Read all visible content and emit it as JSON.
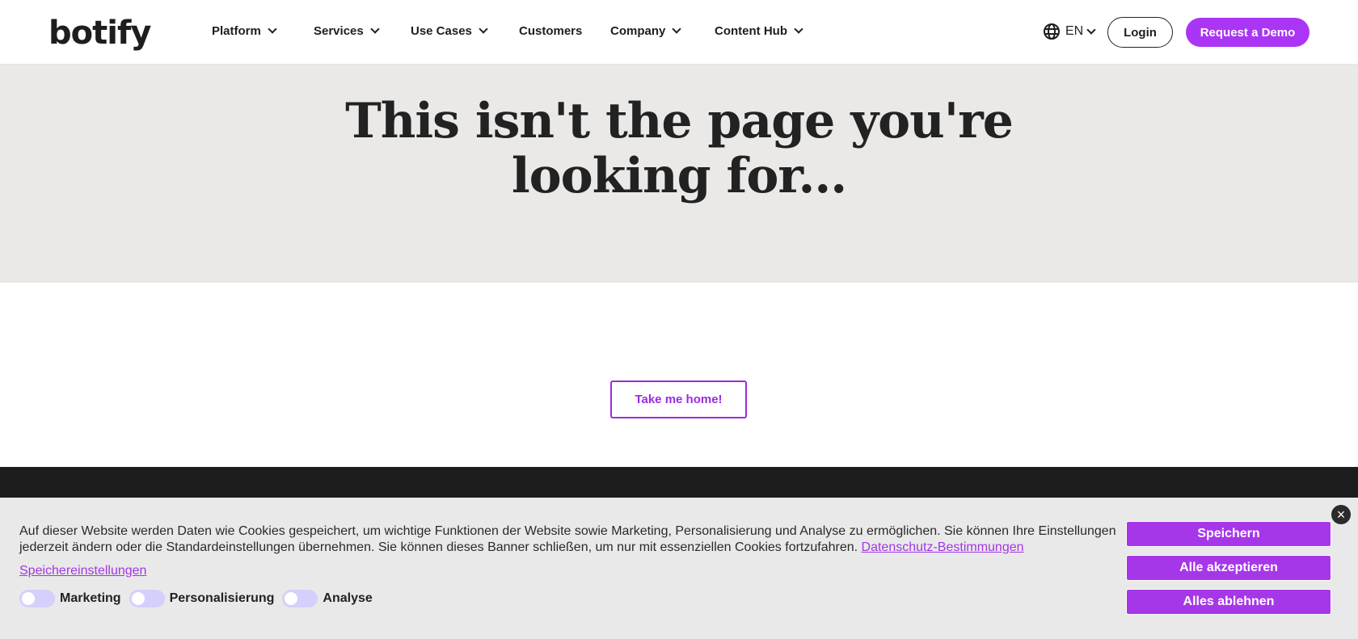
{
  "nav": {
    "logo": "botify",
    "items": [
      {
        "label": "Platform",
        "dropdown": true
      },
      {
        "label": "Services",
        "dropdown": true
      },
      {
        "label": "Use Cases",
        "dropdown": true
      },
      {
        "label": "Customers",
        "dropdown": false
      },
      {
        "label": "Company",
        "dropdown": true
      },
      {
        "label": "Content Hub",
        "dropdown": true
      }
    ],
    "language": "EN",
    "login": "Login",
    "demo": "Request a Demo"
  },
  "hero": {
    "line1": "This isn't the page you're",
    "line2": "looking for..."
  },
  "main": {
    "home_button": "Take me home!"
  },
  "cookie": {
    "text": "Auf dieser Website werden Daten wie Cookies gespeichert, um wichtige Funktionen der Website sowie Marketing, Personalisierung und Analyse zu ermöglichen. Sie können Ihre Einstellungen jederzeit ändern oder die Standardeinstellungen übernehmen. Sie können dieses Banner schließen, um nur mit essenziellen Cookies fortzufahren.",
    "privacy_link": "Datenschutz-Bestimmungen",
    "settings_link": "Speichereinstellungen",
    "toggles": [
      {
        "label": "Marketing",
        "on": false
      },
      {
        "label": "Personalisierung",
        "on": false
      },
      {
        "label": "Analyse",
        "on": false
      }
    ],
    "buttons": {
      "save": "Speichern",
      "accept": "Alle akzeptieren",
      "reject": "Alles ablehnen"
    },
    "close": "×"
  },
  "colors": {
    "accent": "#aa35f5",
    "hero_bg": "#ebe9e7",
    "footer_bg": "#1d1d1d",
    "banner_bg": "#e9e9e9"
  }
}
